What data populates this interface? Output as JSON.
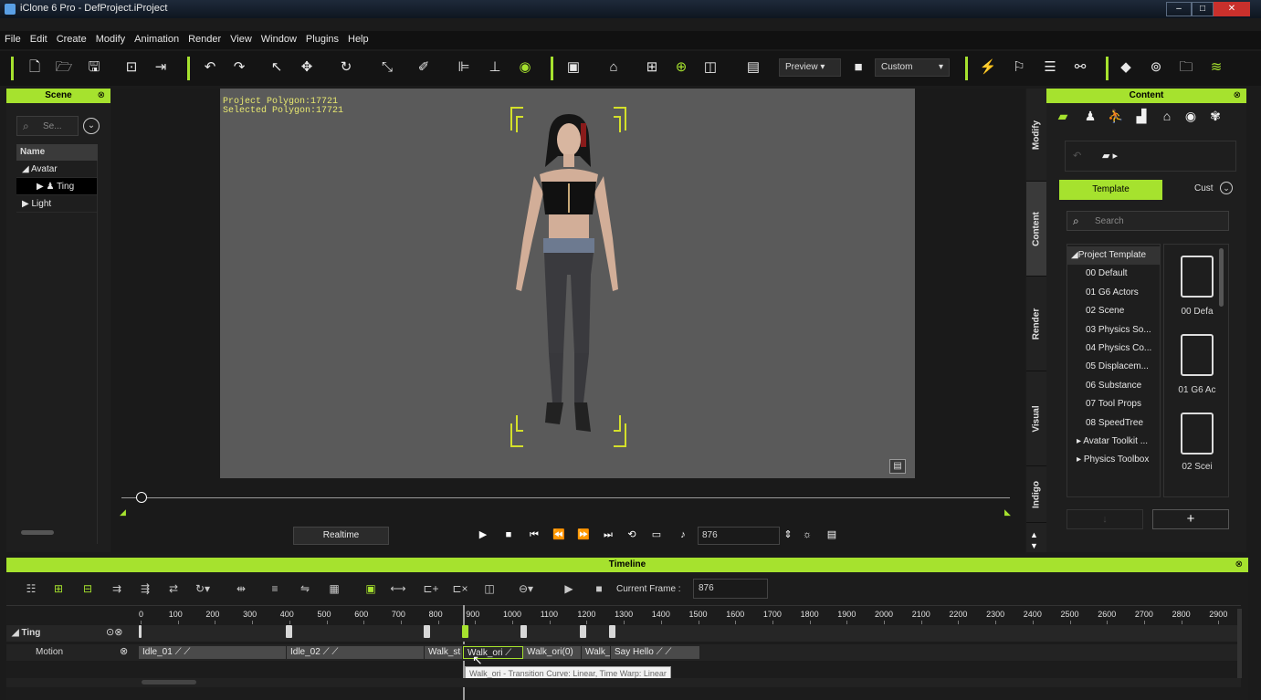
{
  "window": {
    "title": "iClone 6 Pro - DefProject.iProject",
    "minimize": "–",
    "maximize": "□",
    "close": "✕"
  },
  "menu": [
    "File",
    "Edit",
    "Create",
    "Modify",
    "Animation",
    "Render",
    "View",
    "Window",
    "Plugins",
    "Help"
  ],
  "toolbar": {
    "preview_label": "Preview",
    "camera_label": "Custom"
  },
  "scene": {
    "title": "Scene",
    "search_placeholder": "Se...",
    "column_header": "Name",
    "items": [
      {
        "label": "Avatar"
      },
      {
        "label": "Ting"
      },
      {
        "label": "Light"
      }
    ]
  },
  "viewport": {
    "project_polygon": "Project Polygon:17721",
    "selected_polygon": "Selected Polygon:17721"
  },
  "side_tabs": [
    "Modify",
    "Content",
    "Render",
    "Visual",
    "Indigo"
  ],
  "content": {
    "title": "Content",
    "tab_template": "Template",
    "tab_custom": "Cust",
    "search_placeholder": "Search",
    "tree": [
      "Project Template",
      "00 Default",
      "01 G6 Actors",
      "02 Scene",
      "03 Physics So...",
      "04 Physics Co...",
      "05 Displacem...",
      "06 Substance",
      "07 Tool Props",
      "08 SpeedTree",
      "Avatar Toolkit ...",
      "Physics Toolbox"
    ],
    "thumbnails": [
      "00 Defa",
      "01 G6 Ac",
      "02 Scei"
    ],
    "add_label": "+"
  },
  "playback": {
    "realtime_label": "Realtime",
    "frame_value": "876"
  },
  "timeline": {
    "title": "Timeline",
    "current_frame_label": "Current Frame :",
    "current_frame_value": "876",
    "ruler": [
      "0",
      "100",
      "200",
      "300",
      "400",
      "500",
      "600",
      "700",
      "800",
      "900",
      "1000",
      "1100",
      "1200",
      "1300",
      "1400",
      "1500",
      "1600",
      "1700",
      "1800",
      "1900",
      "2000",
      "2100",
      "2200",
      "2300",
      "2400",
      "2500",
      "2600",
      "2700",
      "2800",
      "2900"
    ],
    "track_name": "Ting",
    "sub_track": "Motion",
    "clips": [
      "Idle_01",
      "Idle_02",
      "Walk_st",
      "Walk_ori",
      "Walk_ori(0)",
      "Walk_",
      "Say Hello"
    ],
    "tooltip": "Walk_ori - Transition Curve: Linear, Time Warp: Linear"
  },
  "colors": {
    "accent": "#a6e22e",
    "viewport_bg": "#5a5a5a",
    "stats_text": "#e8e870"
  }
}
